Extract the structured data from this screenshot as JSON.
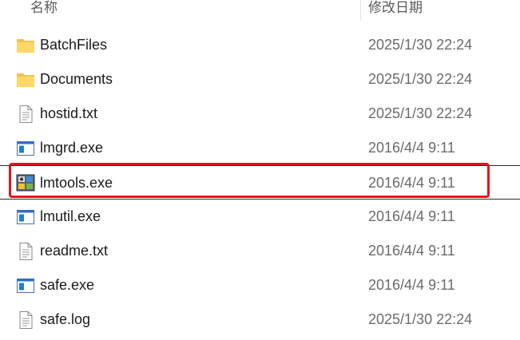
{
  "header": {
    "name_label": "名称",
    "date_label": "修改日期"
  },
  "files": [
    {
      "name": "BatchFiles",
      "date": "2025/1/30 22:24",
      "icon": "folder-icon"
    },
    {
      "name": "Documents",
      "date": "2025/1/30 22:24",
      "icon": "folder-icon"
    },
    {
      "name": "hostid.txt",
      "date": "2025/1/30 22:24",
      "icon": "text-file-icon"
    },
    {
      "name": "lmgrd.exe",
      "date": "2016/4/4 9:11",
      "icon": "exe-icon"
    },
    {
      "name": "lmtools.exe",
      "date": "2016/4/4 9:11",
      "icon": "lmtools-icon"
    },
    {
      "name": "lmutil.exe",
      "date": "2016/4/4 9:11",
      "icon": "exe-icon"
    },
    {
      "name": "readme.txt",
      "date": "2016/4/4 9:11",
      "icon": "text-file-icon"
    },
    {
      "name": "safe.exe",
      "date": "2016/4/4 9:11",
      "icon": "exe-icon"
    },
    {
      "name": "safe.log",
      "date": "2025/1/30 22:24",
      "icon": "text-file-icon"
    }
  ],
  "highlight_color": "#e4141b"
}
